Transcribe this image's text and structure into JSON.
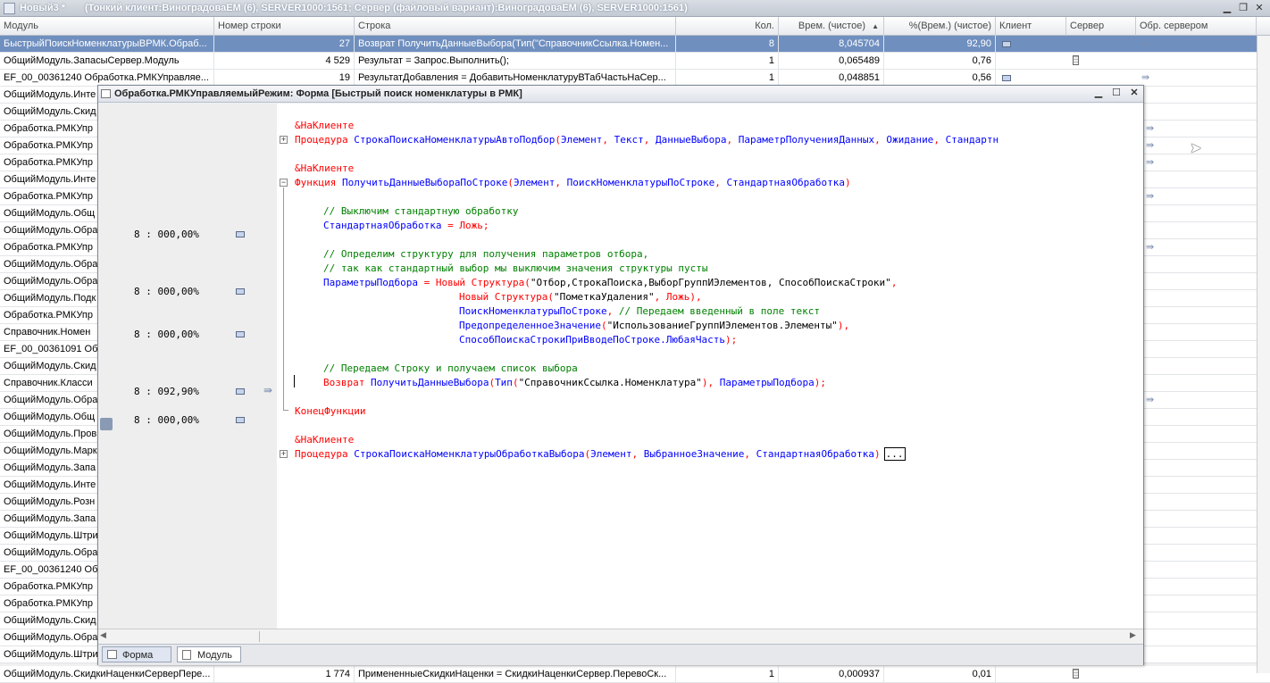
{
  "window": {
    "title": "Новый3 *",
    "info": "(Тонкий клиент:ВиноградоваЕМ (6), SERVER1000:1561; Сервер (файловый вариант):ВиноградоваЕМ (6), SERVER1000:1561)"
  },
  "columns": [
    "Модуль",
    "Номер строки",
    "Строка",
    "Кол.",
    "Врем. (чистое)",
    "%(Врем.) (чистое)",
    "Клиент",
    "Сервер",
    "Обр. сервером"
  ],
  "sort_indicator": "▲",
  "rows": [
    {
      "module": "БыстрыйПоискНоменклатурыВРМК.Обраб...",
      "line": "27",
      "text": "Возврат ПолучитьДанныеВыбора(Тип(\"СправочникСсылка.Номен...",
      "count": "8",
      "time": "8,045704",
      "pct": "92,90",
      "client": "monitor",
      "server": "",
      "obr": "arrow"
    },
    {
      "module": "ОбщийМодуль.ЗапасыСервер.Модуль",
      "line": "4 529",
      "text": "Результат = Запрос.Выполнить();",
      "count": "1",
      "time": "0,065489",
      "pct": "0,76",
      "client": "",
      "server": "server",
      "obr": ""
    },
    {
      "module": "EF_00_00361240 Обработка.РМКУправляе...",
      "line": "19",
      "text": "РезультатДобавления = ДобавитьНоменклатуруВТабЧастьНаСер...",
      "count": "1",
      "time": "0,048851",
      "pct": "0,56",
      "client": "monitor",
      "server": "",
      "obr": "arrow"
    },
    {
      "module": "ОбщийМодуль.Инте"
    },
    {
      "module": "ОбщийМодуль.Скид"
    },
    {
      "module": "Обработка.РМКУпр"
    },
    {
      "module": "Обработка.РМКУпр"
    },
    {
      "module": "Обработка.РМКУпр"
    },
    {
      "module": "ОбщийМодуль.Инте"
    },
    {
      "module": "Обработка.РМКУпр"
    },
    {
      "module": "ОбщийМодуль.Общ"
    },
    {
      "module": "ОбщийМодуль.Обра"
    },
    {
      "module": "Обработка.РМКУпр"
    },
    {
      "module": "ОбщийМодуль.Обра"
    },
    {
      "module": "ОбщийМодуль.Обра"
    },
    {
      "module": "ОбщийМодуль.Подк"
    },
    {
      "module": "Обработка.РМКУпр"
    },
    {
      "module": "Справочник.Номен"
    },
    {
      "module": "EF_00_00361091 Об"
    },
    {
      "module": "ОбщийМодуль.Скид"
    },
    {
      "module": "Справочник.Класси"
    },
    {
      "module": "ОбщийМодуль.Обра"
    },
    {
      "module": "ОбщийМодуль.Общ"
    },
    {
      "module": "ОбщийМодуль.Пров"
    },
    {
      "module": "ОбщийМодуль.Марк"
    },
    {
      "module": "ОбщийМодуль.Запа"
    },
    {
      "module": "ОбщийМодуль.Инте"
    },
    {
      "module": "ОбщийМодуль.Розн"
    },
    {
      "module": "ОбщийМодуль.Запа"
    },
    {
      "module": "ОбщийМодуль.Штри"
    },
    {
      "module": "ОбщийМодуль.Обра"
    },
    {
      "module": "EF_00_00361240 Об"
    },
    {
      "module": "Обработка.РМКУпр"
    },
    {
      "module": "Обработка.РМКУпр"
    },
    {
      "module": "ОбщийМодуль.Скид"
    },
    {
      "module": "ОбщийМодуль.Обра"
    },
    {
      "module": "ОбщийМодуль.Штри"
    },
    {
      "module": "ОбщийМодуль.СкидкиНаценкиСерверПере...",
      "line": "1 774",
      "text": "ПримененныеСкидкиНаценки = СкидкиНаценкиСервер.ПеревоСк...",
      "count": "1",
      "time": "0,000937",
      "pct": "0,01",
      "client": "",
      "server": "server",
      "obr": ""
    }
  ],
  "form": {
    "title": "Обработка.РМКУправляемыйРежим: Форма [Быстрый поиск номенклатуры в РМК]",
    "gutter": [
      "8 : 000,00%",
      "8 : 000,00%",
      "8 : 000,00%",
      "8 : 092,90%",
      "8 : 000,00%"
    ],
    "tabs": [
      "Форма",
      "Модуль"
    ]
  },
  "code": [
    "&НаКлиенте",
    "Процедура СтрокаПоискаНоменклатурыАвтоПодбор(Элемент, Текст, ДанныеВыбора, ПараметрПолученияДанных, Ожидание, Стандартн",
    "&НаКлиенте",
    "Функция ПолучитьДанныеВыбораПоСтроке(Элемент, ПоискНоменклатурыПоСтроке, СтандартнаяОбработка)",
    "// Выключим стандартную обработку",
    "СтандартнаяОбработка = Ложь;",
    "// Определим структуру для получения параметров отбора,",
    "// так как стандартный выбор мы выключим значения структуры пусты",
    "ПараметрыПодбора = Новый Структура(\"Отбор,СтрокаПоиска,ВыборГруппИЭлементов, СпособПоискаСтроки\",",
    "Новый Структура(\"ПометкаУдаления\", Ложь),",
    "ПоискНоменклатурыПоСтроке, // Передаем введенный в поле текст",
    "ПредопределенноеЗначение(\"ИспользованиеГруппИЭлементов.Элементы\"),",
    "СпособПоискаСтрокиПриВводеПоСтроке.ЛюбаяЧасть);",
    "// Передаем Строку и получаем список выбора",
    "Возврат ПолучитьДанныеВыбора(Тип(\"СправочникСсылка.Номенклатура\"), ПараметрыПодбора);",
    "КонецФункции",
    "&НаКлиенте",
    "Процедура СтрокаПоискаНоменклатурыОбработкаВыбора(Элемент, ВыбранноеЗначение, СтандартнаяОбработка)"
  ],
  "ellipsis": "..."
}
